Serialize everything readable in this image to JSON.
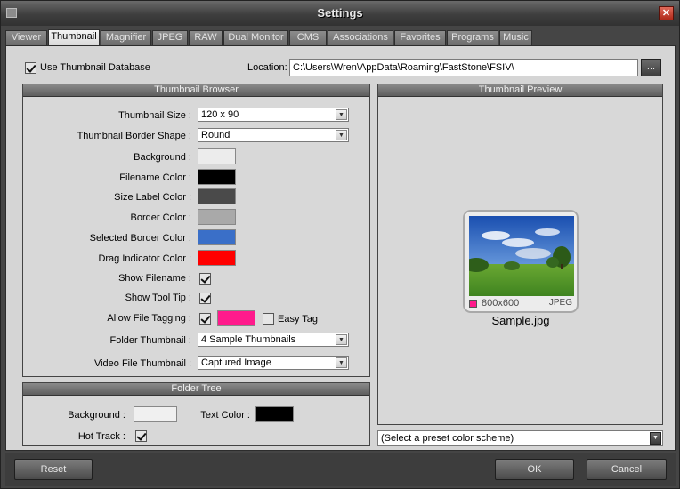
{
  "window": {
    "title": "Settings"
  },
  "tabs": [
    {
      "label": "Viewer"
    },
    {
      "label": "Thumbnail"
    },
    {
      "label": "Magnifier"
    },
    {
      "label": "JPEG"
    },
    {
      "label": "RAW"
    },
    {
      "label": "Dual Monitor"
    },
    {
      "label": "CMS"
    },
    {
      "label": "Associations"
    },
    {
      "label": "Favorites"
    },
    {
      "label": "Programs"
    },
    {
      "label": "Music"
    }
  ],
  "active_tab": "Thumbnail",
  "top": {
    "use_db_label": "Use Thumbnail Database",
    "use_db_checked": true,
    "location_label": "Location:",
    "location_value": "C:\\Users\\Wren\\AppData\\Roaming\\FastStone\\FSIV\\",
    "browse_label": "..."
  },
  "browser": {
    "title": "Thumbnail Browser",
    "size_label": "Thumbnail Size :",
    "size_value": "120 x 90",
    "border_shape_label": "Thumbnail Border Shape :",
    "border_shape_value": "Round",
    "background_label": "Background :",
    "filename_color_label": "Filename Color :",
    "size_label_color_label": "Size Label Color :",
    "border_color_label": "Border Color :",
    "selected_border_color_label": "Selected Border Color :",
    "drag_indicator_color_label": "Drag Indicator Color :",
    "show_filename_label": "Show Filename :",
    "show_tooltip_label": "Show Tool Tip :",
    "allow_tagging_label": "Allow File Tagging :",
    "easy_tag_label": "Easy Tag",
    "folder_thumbnail_label": "Folder Thumbnail :",
    "folder_thumbnail_value": "4 Sample Thumbnails",
    "video_thumbnail_label": "Video File Thumbnail :",
    "video_thumbnail_value": "Captured Image",
    "colors": {
      "background": "#ececec",
      "filename": "#000000",
      "size_label": "#4a4a4a",
      "border": "#a9a9a9",
      "selected_border": "#3a6fc8",
      "drag_indicator": "#ff0000",
      "tag": "#ff1a8c"
    }
  },
  "folder_tree": {
    "title": "Folder Tree",
    "background_label": "Background :",
    "text_color_label": "Text Color :",
    "hot_track_label": "Hot Track :",
    "colors": {
      "background": "#f0f0f0",
      "text": "#000000"
    }
  },
  "preview": {
    "title": "Thumbnail Preview",
    "dimensions": "800x600",
    "format": "JPEG",
    "filename": "Sample.jpg",
    "scheme_placeholder": "(Select a preset color scheme)"
  },
  "footer": {
    "reset_label": "Reset",
    "ok_label": "OK",
    "cancel_label": "Cancel"
  }
}
